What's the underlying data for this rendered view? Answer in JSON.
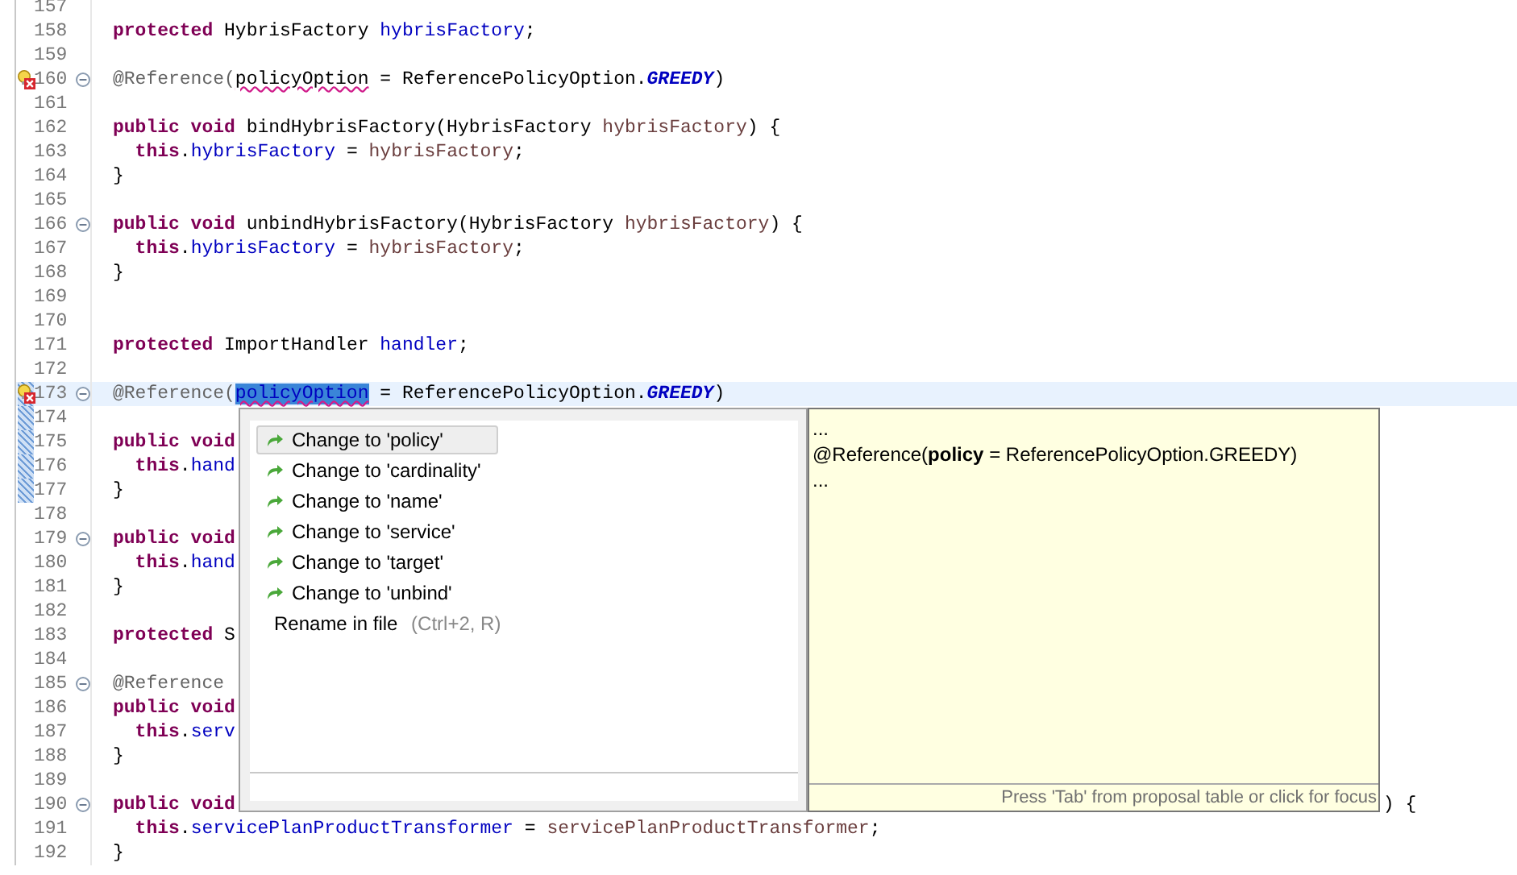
{
  "editor": {
    "lines": [
      {
        "number": "157",
        "current": false,
        "error": false,
        "foldable": false,
        "changed": false
      },
      {
        "number": "158",
        "current": false,
        "error": false,
        "foldable": false,
        "changed": false,
        "tokens": [
          {
            "text": "protected",
            "kind": "keyword"
          },
          {
            "text": " HybrisFactory ",
            "kind": "plain"
          },
          {
            "text": "hybrisFactory",
            "kind": "field"
          },
          {
            "text": ";",
            "kind": "plain"
          }
        ]
      },
      {
        "number": "159",
        "current": false,
        "error": false,
        "foldable": false,
        "changed": false
      },
      {
        "number": "160",
        "current": false,
        "error": true,
        "foldable": true,
        "changed": false,
        "tokens": [
          {
            "text": "@Reference(",
            "kind": "annotation"
          },
          {
            "text": "policyOption",
            "kind": "error"
          },
          {
            "text": " = ReferencePolicyOption.",
            "kind": "plain"
          },
          {
            "text": "GREEDY",
            "kind": "constant"
          },
          {
            "text": ")",
            "kind": "plain"
          }
        ]
      },
      {
        "number": "161",
        "current": false,
        "error": false,
        "foldable": false,
        "changed": false
      },
      {
        "number": "162",
        "current": false,
        "error": false,
        "foldable": false,
        "changed": false,
        "tokens": [
          {
            "text": "public void",
            "kind": "keyword"
          },
          {
            "text": " bindHybrisFactory(HybrisFactory ",
            "kind": "plain"
          },
          {
            "text": "hybrisFactory",
            "kind": "param"
          },
          {
            "text": ") {",
            "kind": "plain"
          }
        ]
      },
      {
        "number": "163",
        "current": false,
        "error": false,
        "foldable": false,
        "changed": false,
        "tokens": [
          {
            "text": "  this",
            "kind": "keyword"
          },
          {
            "text": ".",
            "kind": "plain"
          },
          {
            "text": "hybrisFactory",
            "kind": "field"
          },
          {
            "text": " = ",
            "kind": "plain"
          },
          {
            "text": "hybrisFactory",
            "kind": "param"
          },
          {
            "text": ";",
            "kind": "plain"
          }
        ]
      },
      {
        "number": "164",
        "current": false,
        "error": false,
        "foldable": false,
        "changed": false,
        "tokens": [
          {
            "text": "}",
            "kind": "plain"
          }
        ]
      },
      {
        "number": "165",
        "current": false,
        "error": false,
        "foldable": false,
        "changed": false
      },
      {
        "number": "166",
        "current": false,
        "error": false,
        "foldable": true,
        "changed": false,
        "tokens": [
          {
            "text": "public void",
            "kind": "keyword"
          },
          {
            "text": " unbindHybrisFactory(HybrisFactory ",
            "kind": "plain"
          },
          {
            "text": "hybrisFactory",
            "kind": "param"
          },
          {
            "text": ") {",
            "kind": "plain"
          }
        ]
      },
      {
        "number": "167",
        "current": false,
        "error": false,
        "foldable": false,
        "changed": false,
        "tokens": [
          {
            "text": "  this",
            "kind": "keyword"
          },
          {
            "text": ".",
            "kind": "plain"
          },
          {
            "text": "hybrisFactory",
            "kind": "field"
          },
          {
            "text": " = ",
            "kind": "plain"
          },
          {
            "text": "hybrisFactory",
            "kind": "param"
          },
          {
            "text": ";",
            "kind": "plain"
          }
        ]
      },
      {
        "number": "168",
        "current": false,
        "error": false,
        "foldable": false,
        "changed": false,
        "tokens": [
          {
            "text": "}",
            "kind": "plain"
          }
        ]
      },
      {
        "number": "169",
        "current": false,
        "error": false,
        "foldable": false,
        "changed": false
      },
      {
        "number": "170",
        "current": false,
        "error": false,
        "foldable": false,
        "changed": false
      },
      {
        "number": "171",
        "current": false,
        "error": false,
        "foldable": false,
        "changed": false,
        "tokens": [
          {
            "text": "protected",
            "kind": "keyword"
          },
          {
            "text": " ImportHandler ",
            "kind": "plain"
          },
          {
            "text": "handler",
            "kind": "field"
          },
          {
            "text": ";",
            "kind": "plain"
          }
        ]
      },
      {
        "number": "172",
        "current": false,
        "error": false,
        "foldable": false,
        "changed": false
      },
      {
        "number": "173",
        "current": true,
        "error": true,
        "foldable": true,
        "changed": true,
        "tokens": [
          {
            "text": "@Reference(",
            "kind": "annotation"
          },
          {
            "text": "policyOption",
            "kind": "selection"
          },
          {
            "text": " = ReferencePolicyOption.",
            "kind": "plain"
          },
          {
            "text": "GREEDY",
            "kind": "constant"
          },
          {
            "text": ")",
            "kind": "plain"
          }
        ]
      },
      {
        "number": "174",
        "current": false,
        "error": false,
        "foldable": false,
        "changed": true
      },
      {
        "number": "175",
        "current": false,
        "error": false,
        "foldable": false,
        "changed": true,
        "tokens": [
          {
            "text": "public void",
            "kind": "keyword"
          }
        ]
      },
      {
        "number": "176",
        "current": false,
        "error": false,
        "foldable": false,
        "changed": true,
        "tokens": [
          {
            "text": "  this",
            "kind": "keyword"
          },
          {
            "text": ".",
            "kind": "plain"
          },
          {
            "text": "hand",
            "kind": "field"
          }
        ]
      },
      {
        "number": "177",
        "current": false,
        "error": false,
        "foldable": false,
        "changed": true,
        "tokens": [
          {
            "text": "}",
            "kind": "plain"
          }
        ]
      },
      {
        "number": "178",
        "current": false,
        "error": false,
        "foldable": false,
        "changed": false
      },
      {
        "number": "179",
        "current": false,
        "error": false,
        "foldable": true,
        "changed": false,
        "tokens": [
          {
            "text": "public void",
            "kind": "keyword"
          }
        ]
      },
      {
        "number": "180",
        "current": false,
        "error": false,
        "foldable": false,
        "changed": false,
        "tokens": [
          {
            "text": "  this",
            "kind": "keyword"
          },
          {
            "text": ".",
            "kind": "plain"
          },
          {
            "text": "hand",
            "kind": "field"
          }
        ]
      },
      {
        "number": "181",
        "current": false,
        "error": false,
        "foldable": false,
        "changed": false,
        "tokens": [
          {
            "text": "}",
            "kind": "plain"
          }
        ]
      },
      {
        "number": "182",
        "current": false,
        "error": false,
        "foldable": false,
        "changed": false
      },
      {
        "number": "183",
        "current": false,
        "error": false,
        "foldable": false,
        "changed": false,
        "tokens": [
          {
            "text": "protected",
            "kind": "keyword"
          },
          {
            "text": " S",
            "kind": "plain"
          }
        ]
      },
      {
        "number": "184",
        "current": false,
        "error": false,
        "foldable": false,
        "changed": false
      },
      {
        "number": "185",
        "current": false,
        "error": false,
        "foldable": true,
        "changed": false,
        "tokens": [
          {
            "text": "@Reference",
            "kind": "annotation"
          }
        ]
      },
      {
        "number": "186",
        "current": false,
        "error": false,
        "foldable": false,
        "changed": false,
        "tokens": [
          {
            "text": "public void",
            "kind": "keyword"
          }
        ]
      },
      {
        "number": "187",
        "current": false,
        "error": false,
        "foldable": false,
        "changed": false,
        "tokens": [
          {
            "text": "  this",
            "kind": "keyword"
          },
          {
            "text": ".",
            "kind": "plain"
          },
          {
            "text": "serv",
            "kind": "field"
          }
        ]
      },
      {
        "number": "188",
        "current": false,
        "error": false,
        "foldable": false,
        "changed": false,
        "tokens": [
          {
            "text": "}",
            "kind": "plain"
          }
        ]
      },
      {
        "number": "189",
        "current": false,
        "error": false,
        "foldable": false,
        "changed": false
      },
      {
        "number": "190",
        "current": false,
        "error": false,
        "foldable": true,
        "changed": false,
        "tokens": [
          {
            "text": "public void",
            "kind": "keyword"
          },
          {
            "text": ") {",
            "kind": "tail"
          }
        ]
      },
      {
        "number": "191",
        "current": false,
        "error": false,
        "foldable": false,
        "changed": false,
        "tokens": [
          {
            "text": "  this",
            "kind": "keyword"
          },
          {
            "text": ".",
            "kind": "plain"
          },
          {
            "text": "servicePlanProductTransformer",
            "kind": "field"
          },
          {
            "text": " = ",
            "kind": "plain"
          },
          {
            "text": "servicePlanProductTransformer",
            "kind": "param"
          },
          {
            "text": ";",
            "kind": "plain"
          }
        ]
      },
      {
        "number": "192",
        "current": false,
        "error": false,
        "foldable": false,
        "changed": false,
        "tokens": [
          {
            "text": "}",
            "kind": "plain"
          }
        ]
      }
    ]
  },
  "quick_fix": {
    "proposals": [
      {
        "label": "Change to 'policy'",
        "kind": "change",
        "selected": true
      },
      {
        "label": "Change to 'cardinality'",
        "kind": "change",
        "selected": false
      },
      {
        "label": "Change to 'name'",
        "kind": "change",
        "selected": false
      },
      {
        "label": "Change to 'service'",
        "kind": "change",
        "selected": false
      },
      {
        "label": "Change to 'target'",
        "kind": "change",
        "selected": false
      },
      {
        "label": "Change to 'unbind'",
        "kind": "change",
        "selected": false
      },
      {
        "label": "Rename in file",
        "shortcut": "(Ctrl+2, R)",
        "kind": "rename",
        "selected": false
      }
    ],
    "preview": {
      "lines": [
        "...",
        "@Reference(**policy** = ReferencePolicyOption.GREEDY)",
        "..."
      ],
      "footer": "Press 'Tab' from proposal table or click for focus"
    }
  }
}
